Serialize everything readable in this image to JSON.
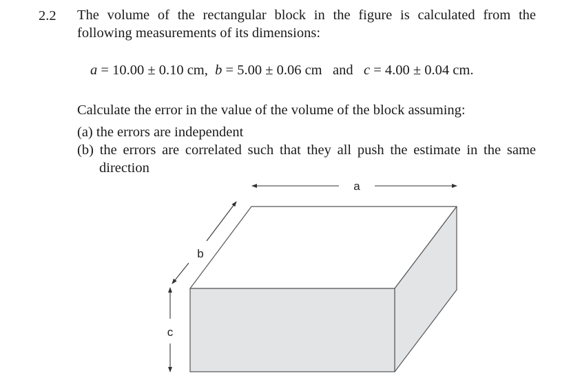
{
  "problem": {
    "number": "2.2",
    "intro_line1": "The volume of the rectangular block in the figure is calculated from the",
    "intro_line2": "following measurements of its dimensions:",
    "measurements": {
      "a": {
        "symbol": "a",
        "value": "10.00",
        "error": "0.10",
        "unit": "cm,"
      },
      "b": {
        "symbol": "b",
        "value": "5.00",
        "error": "0.06",
        "unit": "cm"
      },
      "conjunction": "and",
      "c": {
        "symbol": "c",
        "value": "4.00",
        "error": "0.04",
        "unit": "cm."
      },
      "equals": "=",
      "plusminus": "±"
    },
    "question": "Calculate the error in the value of the volume of the block assuming:",
    "parts": [
      {
        "label": "(a)",
        "text": "the errors are independent"
      },
      {
        "label": "(b)",
        "text_line1": "the errors are correlated such that they all push the estimate in the same",
        "text_line2": "direction"
      }
    ]
  },
  "figure": {
    "labels": {
      "a": "a",
      "b": "b",
      "c": "c"
    },
    "colors": {
      "top_face": "#ffffff",
      "front_face": "#e2e4e6",
      "side_face": "#e2e4e6",
      "edge": "#555555",
      "arrow": "#333333"
    }
  }
}
